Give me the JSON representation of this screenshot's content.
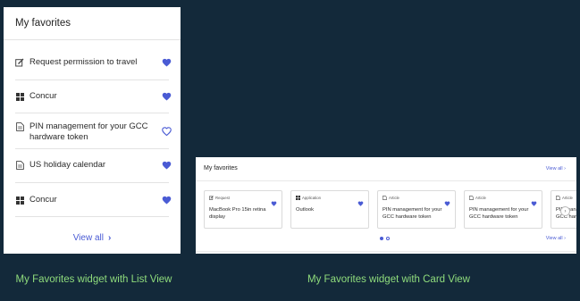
{
  "list_view": {
    "title": "My favorites",
    "items": [
      {
        "label": "Request permission to travel",
        "icon": "edit-icon",
        "favorited": true
      },
      {
        "label": "Concur",
        "icon": "app-grid-icon",
        "favorited": true
      },
      {
        "label": "PIN management for your GCC hardware token",
        "icon": "document-icon",
        "favorited": false
      },
      {
        "label": "US holiday calendar",
        "icon": "document-icon",
        "favorited": true
      },
      {
        "label": "Concur",
        "icon": "app-grid-icon",
        "favorited": true
      }
    ],
    "view_all": "View all"
  },
  "card_view": {
    "title": "My favorites",
    "view_all": "View all",
    "cards": [
      {
        "type": "Request",
        "icon": "edit-icon",
        "title": "MacBook Pro 15in retina display",
        "favorited": true
      },
      {
        "type": "Application",
        "icon": "app-grid-icon",
        "title": "Outlook",
        "favorited": true
      },
      {
        "type": "Article",
        "icon": "document-icon",
        "title": "PIN management for your GCC hardware token",
        "favorited": true
      },
      {
        "type": "Article",
        "icon": "document-icon",
        "title": "PIN management for your GCC hardware token",
        "favorited": true
      },
      {
        "type": "Article",
        "icon": "document-icon",
        "title": "PIN management for your GCC hardware token",
        "favorited": true
      }
    ],
    "pagination": {
      "pages": 2,
      "current": 1
    }
  },
  "captions": {
    "list": "My Favorites widget with List View",
    "card": "My Favorites widget with Card View"
  },
  "colors": {
    "background": "#13293a",
    "accent": "#4a5bd4",
    "caption": "#8fdc7c",
    "panel": "#ffffff"
  }
}
